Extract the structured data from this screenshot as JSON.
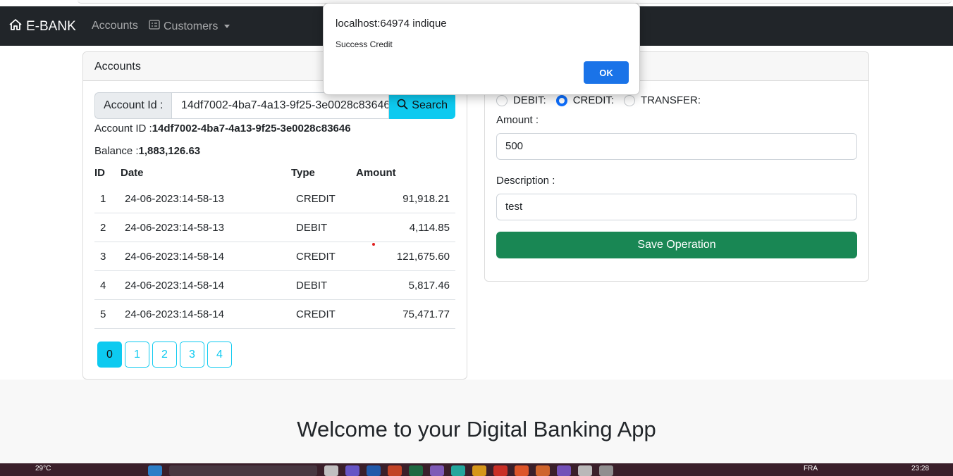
{
  "navbar": {
    "brand": "E-BANK",
    "accounts_link": "Accounts",
    "customers_link": "Customers"
  },
  "accounts_card": {
    "header": "Accounts",
    "search_label": "Account Id :",
    "search_value": "14df7002-4ba7-4a13-9f25-3e0028c83646",
    "search_button": "Search",
    "account_id_label": "Account ID :",
    "account_id_value": "14df7002-4ba7-4a13-9f25-3e0028c83646",
    "balance_label": "Balance :",
    "balance_value": "1,883,126.63",
    "columns": [
      "ID",
      "Date",
      "Type",
      "Amount"
    ],
    "rows": [
      {
        "id": "1",
        "date": "24-06-2023:14-58-13",
        "type": "CREDIT",
        "amount": "91,918.21"
      },
      {
        "id": "2",
        "date": "24-06-2023:14-58-13",
        "type": "DEBIT",
        "amount": "4,114.85"
      },
      {
        "id": "3",
        "date": "24-06-2023:14-58-14",
        "type": "CREDIT",
        "amount": "121,675.60"
      },
      {
        "id": "4",
        "date": "24-06-2023:14-58-14",
        "type": "DEBIT",
        "amount": "5,817.46"
      },
      {
        "id": "5",
        "date": "24-06-2023:14-58-14",
        "type": "CREDIT",
        "amount": "75,471.77"
      }
    ],
    "pages": [
      "0",
      "1",
      "2",
      "3",
      "4"
    ],
    "active_page": "0"
  },
  "operations_card": {
    "radio_debit": "DEBIT:",
    "radio_credit": "CREDIT:",
    "radio_transfer": "TRANSFER:",
    "selected_operation": "CREDIT",
    "amount_label": "Amount :",
    "amount_value": "500",
    "description_label": "Description :",
    "description_value": "test",
    "save_button": "Save Operation"
  },
  "footer": {
    "welcome": "Welcome to your Digital Banking App"
  },
  "alert_dialog": {
    "title": "localhost:64974 indique",
    "message": "Success Credit",
    "ok_button": "OK"
  },
  "taskbar": {
    "temperature": "29°C",
    "language": "FRA",
    "time": "23:28"
  },
  "colors": {
    "navbar": "#212529",
    "info": "#0dcaf0",
    "success": "#198754",
    "primary": "#0d6efd",
    "dialog_button": "#1a73e8"
  }
}
